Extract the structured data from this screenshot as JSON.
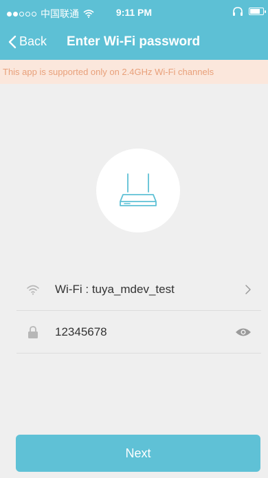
{
  "status_bar": {
    "carrier": "中国联通",
    "time": "9:11 PM"
  },
  "nav": {
    "back_label": "Back",
    "title": "Enter Wi-Fi password"
  },
  "banner": {
    "text": "This app is supported only on 2.4GHz Wi-Fi channels"
  },
  "wifi_row": {
    "label": "Wi-Fi : tuya_mdev_test"
  },
  "password_row": {
    "value": "12345678"
  },
  "buttons": {
    "next_label": "Next"
  },
  "colors": {
    "header": "#5dc0d5",
    "banner_bg": "#fbe7dc",
    "banner_text": "#e8a07a",
    "button": "#5fc1d6"
  }
}
